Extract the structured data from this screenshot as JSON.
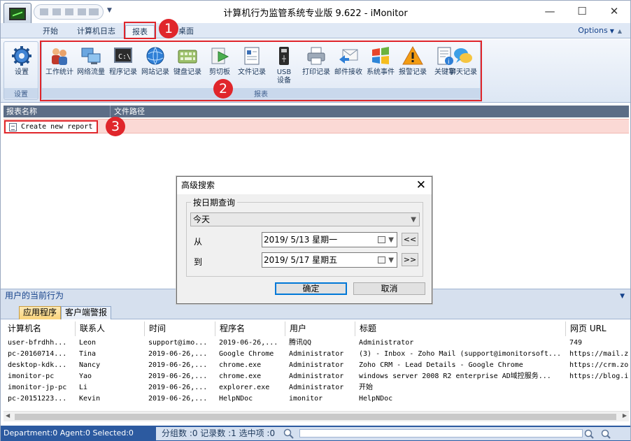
{
  "window": {
    "title": "计算机行为监管系统专业版 9.622 - iMonitor",
    "controls": {
      "minimize": "—",
      "maximize": "☐",
      "close": "✕"
    }
  },
  "ribbon_tabs": [
    "开始",
    "计算机日志",
    "报表",
    "桌面"
  ],
  "options_label": "Options",
  "groups": {
    "settings_button": "设置",
    "settings_group": "设置",
    "reports_group": "报表"
  },
  "report_buttons": [
    {
      "label": "工作统计",
      "icon": "work-stats-icon"
    },
    {
      "label": "网络流量",
      "icon": "network-traffic-icon"
    },
    {
      "label": "程序记录",
      "icon": "program-record-icon"
    },
    {
      "label": "网站记录",
      "icon": "website-record-icon"
    },
    {
      "label": "键盘记录",
      "icon": "keyboard-record-icon"
    },
    {
      "label": "剪切板",
      "icon": "clipboard-icon"
    },
    {
      "label": "文件记录",
      "icon": "file-record-icon"
    },
    {
      "label": "USB\n设备",
      "icon": "usb-icon"
    },
    {
      "label": "打印记录",
      "icon": "printer-icon"
    },
    {
      "label": "邮件接收",
      "icon": "mail-icon"
    },
    {
      "label": "系统事件",
      "icon": "windows-icon"
    },
    {
      "label": "报警记录",
      "icon": "warning-icon"
    },
    {
      "label": "关键字",
      "icon": "keyword-icon"
    },
    {
      "label": "聊天记录",
      "icon": "chat-icon"
    }
  ],
  "annotations": [
    "1",
    "2",
    "3"
  ],
  "report_list": {
    "columns": [
      "报表名称",
      "文件路径"
    ],
    "item": "Create new report"
  },
  "dialog": {
    "title": "高级搜索",
    "group_label": "按日期查询",
    "preset": "今天",
    "from_label": "从",
    "from_date": "2019/ 5/13 星期一",
    "to_label": "到",
    "to_date": "2019/ 5/17 星期五",
    "prev": "<<",
    "next": ">>",
    "ok": "确定",
    "cancel": "取消"
  },
  "activity": {
    "title": "用户的当前行为",
    "tabs": [
      "应用程序",
      "客户端警报"
    ],
    "columns": [
      "计算机名",
      "联系人",
      "时间",
      "程序名",
      "用户",
      "标题",
      "网页 URL"
    ],
    "rows": [
      [
        "user-bfrdhh...",
        "Leon",
        "support@imo...",
        "2019-06-26,...",
        "腾讯QQ",
        "Administrator",
        "749"
      ],
      [
        "pc-20160714...",
        "Tina",
        "2019-06-26,...",
        "Google Chrome",
        "Administrator",
        "(3) - Inbox - Zoho Mail (support@imonitorsoft...",
        "https://mail.z"
      ],
      [
        "desktop-kdk...",
        "Nancy",
        "2019-06-26,...",
        "chrome.exe",
        "Administrator",
        "Zoho CRM - Lead Details - Google Chrome",
        "https://crm.zo"
      ],
      [
        "imonitor-pc",
        "Yao",
        "2019-06-26,...",
        "chrome.exe",
        "Administrator",
        "windows server 2008 R2 enterprise AD域控服务...",
        "https://blog.i"
      ],
      [
        "imonitor-jp-pc",
        "Li",
        "2019-06-26,...",
        "explorer.exe",
        "Administrator",
        "开始",
        ""
      ],
      [
        "pc-20151223...",
        "Kevin",
        "2019-06-26,...",
        "HelpNDoc",
        "imonitor",
        "HelpNDoc",
        ""
      ]
    ]
  },
  "status": {
    "left": "Department:0  Agent:0  Selected:0",
    "mid": "分组数 :0  记录数 :1  选中项 :0"
  }
}
